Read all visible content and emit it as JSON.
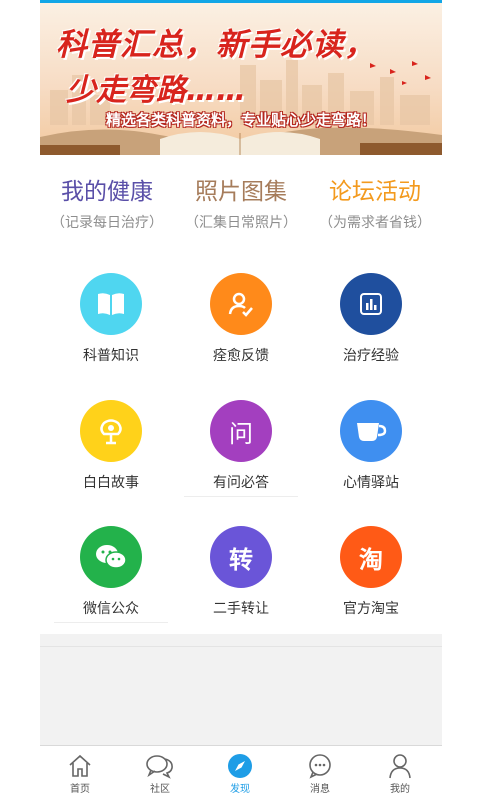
{
  "banner": {
    "title_line1": "科普汇总，新手必读，",
    "title_line2": "少走弯路……",
    "subtitle": "精选各类科普资料，专业贴心少走弯路！"
  },
  "features": [
    {
      "title": "我的健康",
      "subtitle": "（记录每日治疗）",
      "color": "#5a4fa8"
    },
    {
      "title": "照片图集",
      "subtitle": "（汇集日常照片）",
      "color": "#a67c5b"
    },
    {
      "title": "论坛活动",
      "subtitle": "（为需求者省钱）",
      "color": "#f39a1e"
    }
  ],
  "grid": [
    {
      "label": "科普知识",
      "icon": "book-icon",
      "color": "#4fd6f0"
    },
    {
      "label": "痊愈反馈",
      "icon": "user-check-icon",
      "color": "#ff8a1a"
    },
    {
      "label": "治疗经验",
      "icon": "chart-icon",
      "color": "#1f4f9e"
    },
    {
      "label": "白白故事",
      "icon": "flower-icon",
      "color": "#ffd21a"
    },
    {
      "label": "有问必答",
      "icon": "question-icon",
      "glyph": "问",
      "color": "#a33fbf"
    },
    {
      "label": "心情驿站",
      "icon": "cup-icon",
      "color": "#3f8ff0"
    },
    {
      "label": "微信公众",
      "icon": "wechat-icon",
      "color": "#23b24b"
    },
    {
      "label": "二手转让",
      "icon": "transfer-icon",
      "glyph": "转",
      "color": "#6a55d8"
    },
    {
      "label": "官方淘宝",
      "icon": "taobao-icon",
      "glyph": "淘",
      "color": "#ff5a16"
    }
  ],
  "tabbar": {
    "items": [
      {
        "label": "首页",
        "icon": "home-icon"
      },
      {
        "label": "社区",
        "icon": "chat-bubbles-icon"
      },
      {
        "label": "发现",
        "icon": "compass-icon"
      },
      {
        "label": "消息",
        "icon": "message-icon"
      },
      {
        "label": "我的",
        "icon": "person-icon"
      }
    ],
    "active_label": "发现",
    "active_color": "#1e9de6"
  }
}
